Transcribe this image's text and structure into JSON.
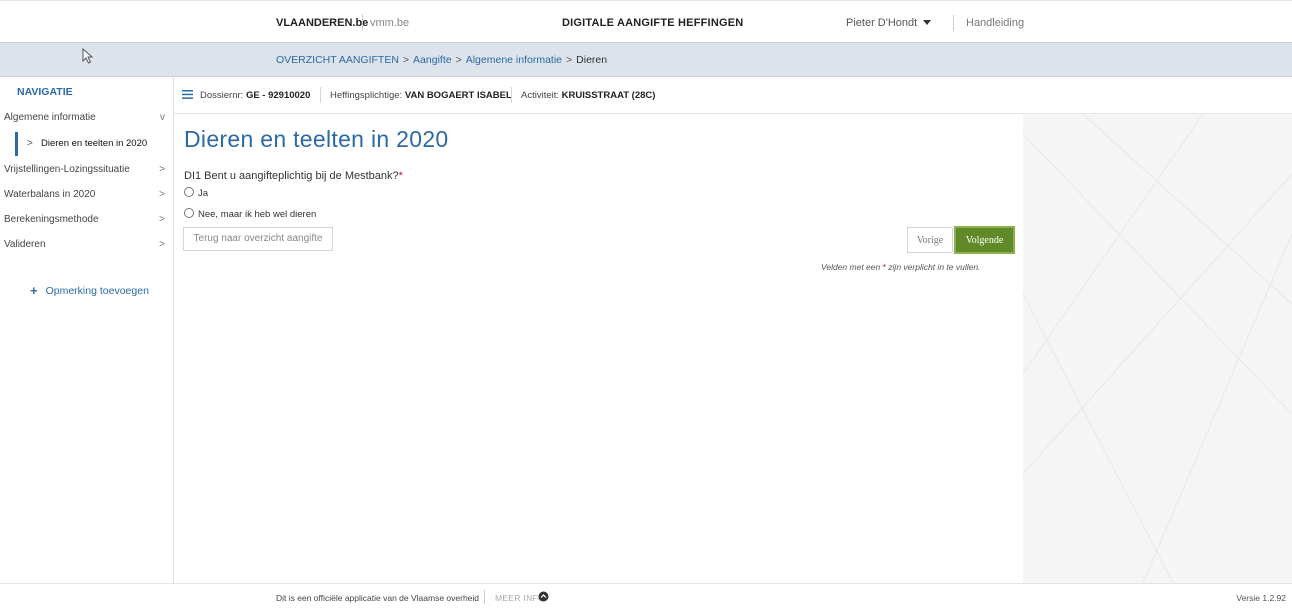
{
  "topbar": {
    "brand": "VLAANDEREN.be",
    "site": "vmm.be",
    "app_name": "DIGITALE AANGIFTE HEFFINGEN",
    "user": "Pieter D'Hondt",
    "help": "Handleiding"
  },
  "breadcrumb": {
    "items": [
      "OVERZICHT AANGIFTEN",
      "Aangifte",
      "Algemene informatie",
      "Dieren"
    ],
    "separator": ">"
  },
  "sidebar": {
    "title": "NAVIGATIE",
    "items": [
      {
        "label": "Algemene informatie",
        "chevron": "v"
      },
      {
        "label": "Dieren en teelten in 2020",
        "chevron": ">"
      },
      {
        "label": "Vrijstellingen-Lozingssituatie",
        "chevron": ">"
      },
      {
        "label": "Waterbalans in 2020",
        "chevron": ">"
      },
      {
        "label": "Berekeningsmethode",
        "chevron": ">"
      },
      {
        "label": "Valideren",
        "chevron": ">"
      }
    ],
    "add_note": "Opmerking toevoegen"
  },
  "infobar": {
    "dossier_label": "Dossiernr:",
    "dossier_value": "GE - 92910020",
    "taxpayer_label": "Heffingsplichtige:",
    "taxpayer_value": "VAN BOGAERT ISABEL",
    "activity_label": "Activiteit:",
    "activity_value": "KRUISSTRAAT (28C)"
  },
  "main": {
    "title": "Dieren en teelten in 2020",
    "question": "DI1 Bent u aangifteplichtig bij de Mestbank?",
    "required_mark": "*",
    "options": [
      "Ja",
      "Nee, maar ik heb wel dieren"
    ],
    "back_button": "Terug naar overzicht aangifte",
    "prev_button": "Vorige",
    "next_button": "Volgende",
    "hint_before": "Velden met een",
    "hint_after": "zijn verplicht in te vullen."
  },
  "footer": {
    "official": "Dit is een officiële applicatie van de Vlaamse overheid",
    "more_info": "MEER INFO",
    "version": "Versie 1.2.92"
  },
  "colors": {
    "accent": "#2b6aa5",
    "primary_button": "#5f8a27",
    "required": "#c8102e",
    "breadcrumb_bg": "#dce3ea"
  }
}
